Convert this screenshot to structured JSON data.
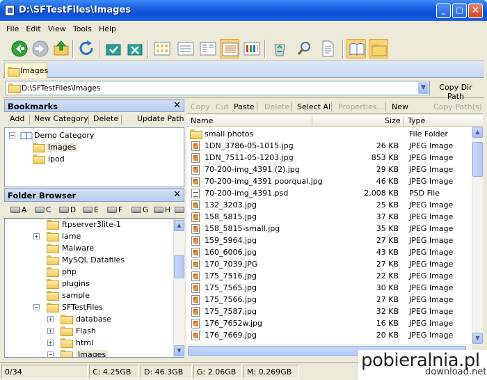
{
  "window": {
    "title": "D:\\SFTestFiles\\Images",
    "min": "_",
    "max": "□",
    "close": "✕"
  },
  "menu": [
    "File",
    "Edit",
    "View",
    "Tools",
    "Help"
  ],
  "tab": {
    "label": "Images"
  },
  "address": {
    "path": "D:\\SFTestFiles\\Images",
    "copy_label": "Copy Dir Path"
  },
  "bookmarks": {
    "title": "Bookmarks",
    "close": "✕",
    "buttons": [
      "Add",
      "New Category",
      "Delete",
      "Update Path"
    ],
    "category": "Demo Category",
    "items": [
      "Images",
      "ipod"
    ]
  },
  "folder_browser": {
    "title": "Folder Browser",
    "close": "✕",
    "drives": [
      "A",
      "C",
      "D",
      "E",
      "F",
      "G",
      "H"
    ],
    "tree": [
      {
        "label": "ftpserver3lite-1",
        "pm": ""
      },
      {
        "label": "lame",
        "pm": "+"
      },
      {
        "label": "Malware",
        "pm": ""
      },
      {
        "label": "MySQL Datafiles",
        "pm": ""
      },
      {
        "label": "php",
        "pm": ""
      },
      {
        "label": "plugins",
        "pm": ""
      },
      {
        "label": "sample",
        "pm": ""
      },
      {
        "label": "SFTestFiles",
        "pm": "−"
      },
      {
        "label": "database",
        "pm": "+"
      },
      {
        "label": "Flash",
        "pm": "+"
      },
      {
        "label": "html",
        "pm": "+"
      },
      {
        "label": "Images",
        "pm": "−"
      }
    ]
  },
  "actions": {
    "items": [
      {
        "label": "Copy",
        "enabled": false
      },
      {
        "label": "Cut",
        "enabled": false
      },
      {
        "label": "Paste",
        "enabled": true
      },
      {
        "label": "Delete",
        "enabled": false
      },
      {
        "label": "Select All",
        "enabled": true
      },
      {
        "label": "Properties...",
        "enabled": false
      },
      {
        "label": "New",
        "enabled": true
      },
      {
        "label": "Copy Path(s)",
        "enabled": false
      }
    ]
  },
  "file_columns": {
    "name": "Name",
    "size": "Size",
    "type": "Type"
  },
  "files": [
    {
      "name": "small photos",
      "size": "",
      "type": "File Folder",
      "kind": "folder"
    },
    {
      "name": "1DN_3786-05-1015.jpg",
      "size": "26 KB",
      "type": "JPEG Image",
      "kind": "jpg"
    },
    {
      "name": "1DN_7511-05-1203.jpg",
      "size": "853 KB",
      "type": "JPEG Image",
      "kind": "jpg"
    },
    {
      "name": "70-200-img_4391 (2).jpg",
      "size": "29 KB",
      "type": "JPEG Image",
      "kind": "jpg"
    },
    {
      "name": "70-200-img_4391 poorqual.jpg",
      "size": "46 KB",
      "type": "JPEG Image",
      "kind": "jpg"
    },
    {
      "name": "70-200-img_4391.psd",
      "size": "2,008 KB",
      "type": "PSD File",
      "kind": "psd"
    },
    {
      "name": "132_3203.jpg",
      "size": "25 KB",
      "type": "JPEG Image",
      "kind": "jpg"
    },
    {
      "name": "158_5815.jpg",
      "size": "37 KB",
      "type": "JPEG Image",
      "kind": "jpg"
    },
    {
      "name": "158_5815-small.jpg",
      "size": "35 KB",
      "type": "JPEG Image",
      "kind": "jpg"
    },
    {
      "name": "159_5964.jpg",
      "size": "27 KB",
      "type": "JPEG Image",
      "kind": "jpg"
    },
    {
      "name": "160_6006.jpg",
      "size": "43 KB",
      "type": "JPEG Image",
      "kind": "jpg"
    },
    {
      "name": "170_7039.JPG",
      "size": "27 KB",
      "type": "JPEG Image",
      "kind": "jpg"
    },
    {
      "name": "175_7516.jpg",
      "size": "22 KB",
      "type": "JPEG Image",
      "kind": "jpg"
    },
    {
      "name": "175_7565.jpg",
      "size": "30 KB",
      "type": "JPEG Image",
      "kind": "jpg"
    },
    {
      "name": "175_7566.jpg",
      "size": "27 KB",
      "type": "JPEG Image",
      "kind": "jpg"
    },
    {
      "name": "175_7587.jpg",
      "size": "32 KB",
      "type": "JPEG Image",
      "kind": "jpg"
    },
    {
      "name": "176_7652w.jpg",
      "size": "16 KB",
      "type": "JPEG Image",
      "kind": "jpg"
    },
    {
      "name": "176_7669.jpg",
      "size": "20 KB",
      "type": "JPEG Image",
      "kind": "jpg"
    }
  ],
  "status": [
    "0/34",
    "C: 4.25GB",
    "D: 46.3GB",
    "G: 2.06GB",
    "M: 0.269GB"
  ],
  "watermark": {
    "main": "pobieralnia.pl",
    "sub": "download.net.pl"
  }
}
